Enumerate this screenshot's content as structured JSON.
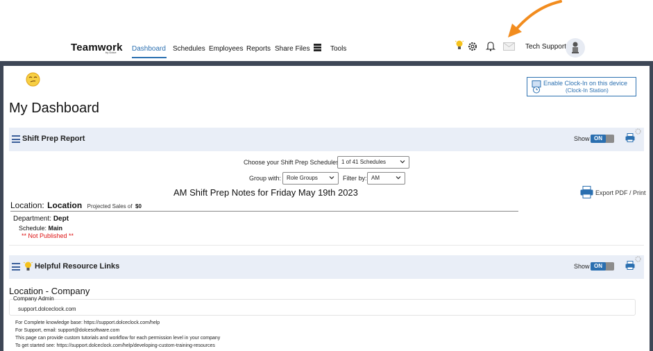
{
  "topnav": {
    "logo": "Teamwork",
    "logo_by": "by Dolce",
    "links": {
      "dashboard": "Dashboard",
      "schedules": "Schedules",
      "employees": "Employees",
      "reports": "Reports",
      "share_files": "Share Files",
      "tools": "Tools"
    },
    "user_name": "Tech Support",
    "icons": [
      "bulb-icon",
      "gear-icon",
      "bell-icon",
      "mail-icon",
      "printer-stack-icon",
      "avatar"
    ]
  },
  "header": {
    "title": "My Dashboard",
    "clockin_line1": "Enable Clock-In on this device",
    "clockin_line2": "(Clock-In Station)"
  },
  "shift_prep": {
    "title": "Shift Prep Report",
    "show_label": "Show",
    "toggle_label": "ON",
    "choose_label": "Choose your Shift Prep Schedules",
    "choose_value": "1 of 41 Schedules",
    "group_label": "Group with:",
    "group_value": "Role Groups",
    "filter_label": "Filter by:",
    "filter_value": "AM",
    "notes_title": "AM Shift Prep Notes for Friday May 19th 2023",
    "export_label": "Export PDF / Print",
    "location_label": "Location:",
    "location_value": "Location",
    "projected_label": "Projected Sales of",
    "projected_value": "$0",
    "department_label": "Department:",
    "department_value": "Dept",
    "schedule_label": "Schedule:",
    "schedule_value": "Main",
    "not_published": "** Not Published **"
  },
  "resources": {
    "title": "Helpful Resource Links",
    "show_label": "Show",
    "toggle_label": "ON",
    "location_company": "Location - Company",
    "company_admin": "Company Admin",
    "support_url": "support.dolceclock.com",
    "info_lines": [
      "For Complete knowledge base: https://support.dolceclock.com/help",
      "For Support, email: support@dolcesoftware.com",
      "This page can provide custom tutorials and workflow for each permission level in your company",
      "To get started see: https://support.dolceclock.com/help/developing-custom-training-resources"
    ]
  },
  "colors": {
    "accent": "#2a6fb0",
    "frame": "#3e4756",
    "section_bg": "#e9eef7",
    "annotation_arrow": "#f28c1e",
    "not_published": "#dd1111"
  }
}
